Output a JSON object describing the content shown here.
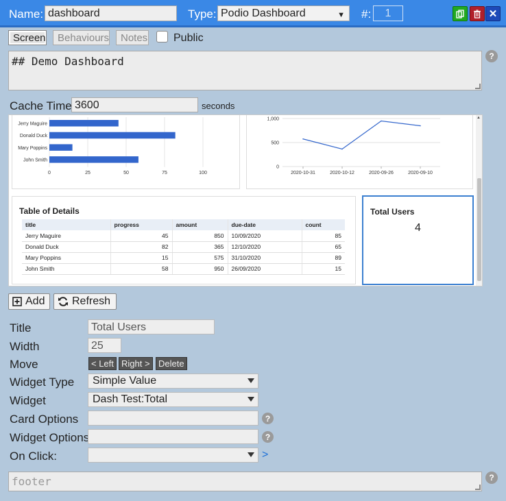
{
  "header": {
    "name_label": "Name:",
    "name_value": "dashboard",
    "type_label": "Type:",
    "type_value": "Podio Dashboard",
    "number_label": "#:",
    "number_value": "1",
    "copy_icon": "copy-icon",
    "delete_icon": "trash-icon",
    "close_icon": "close-icon"
  },
  "tabs": [
    {
      "label": "Screen",
      "active": true
    },
    {
      "label": "Behaviours",
      "active": false
    },
    {
      "label": "Notes",
      "active": false
    }
  ],
  "public_label": "Public",
  "header_text": "## Demo Dashboard",
  "cache": {
    "label": "Cache Time",
    "value": "3600",
    "unit": "seconds"
  },
  "preview": {
    "bar_chart": {
      "type": "bar",
      "categories": [
        "Jerry Maguire",
        "Donald Duck",
        "Mary Poppins",
        "John Smith"
      ],
      "values": [
        45,
        82,
        15,
        58
      ],
      "xlim": [
        0,
        100
      ],
      "xticks": [
        "0",
        "25",
        "50",
        "75",
        "100"
      ]
    },
    "line_chart": {
      "type": "line",
      "x": [
        "2020-10-31",
        "2020-10-12",
        "2020-09-26",
        "2020-09-10"
      ],
      "values": [
        575,
        365,
        950,
        850
      ],
      "ylim": [
        0,
        1000
      ],
      "yticks": [
        "0",
        "500",
        "1,000"
      ]
    },
    "table": {
      "title": "Table of Details",
      "columns": [
        "title",
        "progress",
        "amount",
        "due-date",
        "count"
      ],
      "rows": [
        [
          "Jerry Maguire",
          "45",
          "850",
          "10/09/2020",
          "85"
        ],
        [
          "Donald Duck",
          "82",
          "365",
          "12/10/2020",
          "65"
        ],
        [
          "Mary Poppins",
          "15",
          "575",
          "31/10/2020",
          "89"
        ],
        [
          "John Smith",
          "58",
          "950",
          "26/09/2020",
          "15"
        ]
      ]
    },
    "total": {
      "title": "Total Users",
      "value": "4"
    }
  },
  "actions": {
    "add": "Add",
    "refresh": "Refresh"
  },
  "form": {
    "title_label": "Title",
    "title_value": "Total Users",
    "width_label": "Width",
    "width_value": "25",
    "move_label": "Move",
    "move_left": "< Left",
    "move_right": "Right >",
    "move_delete": "Delete",
    "widget_type_label": "Widget Type",
    "widget_type_value": "Simple Value",
    "widget_label": "Widget",
    "widget_value": "Dash Test:Total",
    "card_options_label": "Card Options",
    "card_options_value": "",
    "widget_options_label": "Widget Options",
    "widget_options_value": "",
    "onclick_label": "On Click:",
    "onclick_value": "",
    "onclick_link": ">"
  },
  "footer": {
    "placeholder": "footer"
  },
  "colors": {
    "header_blue": "#3a88e6",
    "bar_blue": "#3366cc",
    "green": "#20a020",
    "red": "#b0202a",
    "navy": "#1d49b8"
  }
}
